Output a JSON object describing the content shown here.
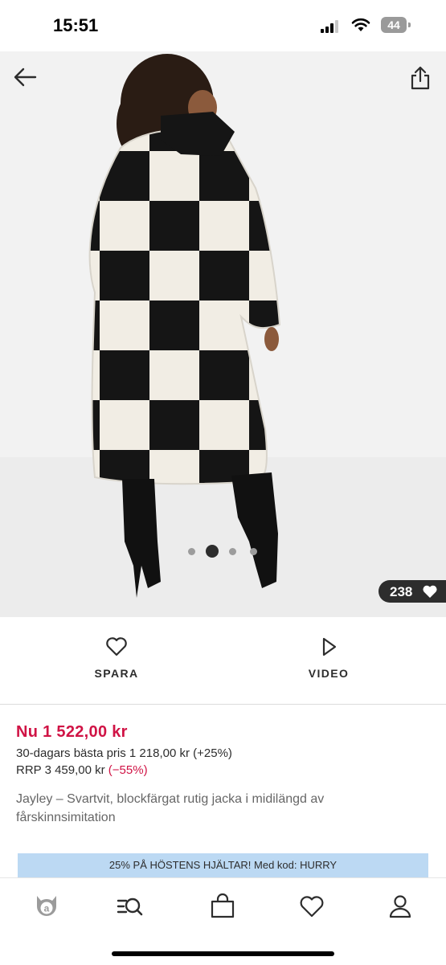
{
  "status_bar": {
    "time": "15:51",
    "battery": "44"
  },
  "product_image": {
    "alt": "Jayley – Svartvit, blockfärgat rutig jacka i midilängd av fårskinnsimitation",
    "dots": 4,
    "active_dot_index": 1,
    "likes": "238"
  },
  "actions": {
    "save_label": "SPARA",
    "video_label": "VIDEO"
  },
  "price": {
    "now": "Nu 1 522,00 kr",
    "best_30_days": "30-dagars bästa pris 1 218,00 kr (+25%)",
    "rrp": "RRP 3 459,00 kr",
    "rrp_discount": "(−55%)"
  },
  "product": {
    "title": "Jayley – Svartvit, blockfärgat rutig jacka i midilängd av fårskinnsimitation"
  },
  "promo": {
    "text": "25% PÅ HÖSTENS HJÄLTAR! Med kod: HURRY"
  },
  "nav": {
    "items": [
      "home-icon",
      "search-icon",
      "bag-icon",
      "saved-heart-icon",
      "account-icon"
    ]
  },
  "colors": {
    "sale_red": "#d01345",
    "banner_blue": "#bcd9f3",
    "text_dark": "#2d2d2d"
  }
}
